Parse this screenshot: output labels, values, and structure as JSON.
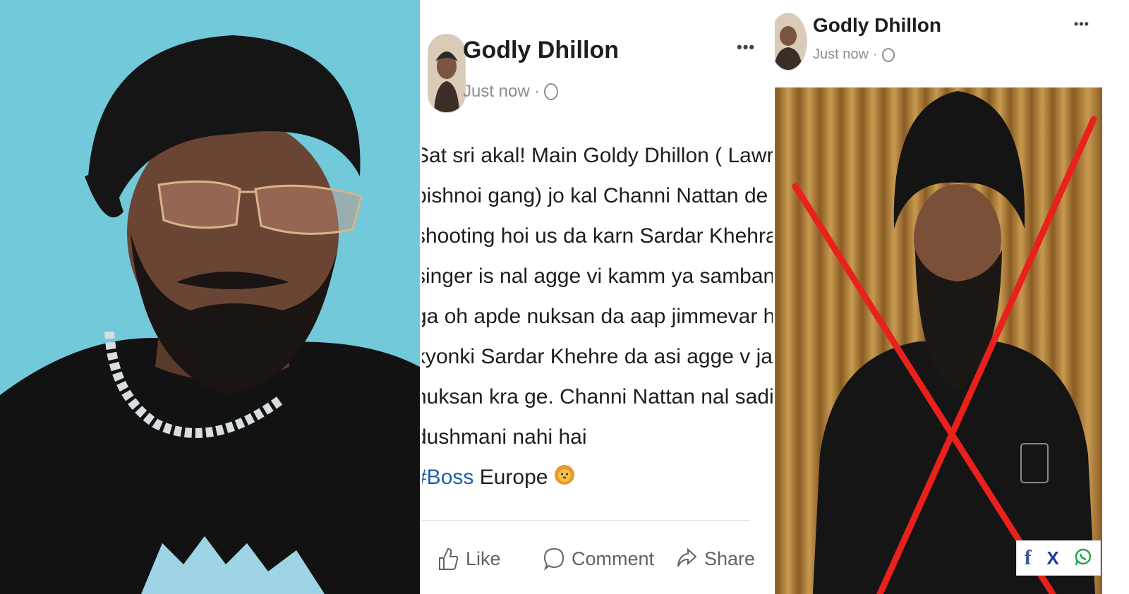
{
  "middle_post": {
    "author": "Godly Dhillon",
    "timestamp": "Just now",
    "separator": "·",
    "menu_icon": "more-dots-icon",
    "text_lines": [
      "Sat sri akal! Main Goldy Dhillon ( Lawrence",
      "bishnoi gang) jo kal Channi Nattan de ghar",
      "shooting hoi us da karn Sardar Khehra hai jo v",
      "singer is nal agge vi kamm ya sambandh rakhe",
      "ga oh apde nuksan da aap jimmevar hove ga",
      "kyonki Sardar Khehre da asi agge v jani mani",
      "nuksan kra ge. Channi Nattan nal sadi koi nijji",
      "dushmani nahi hai"
    ],
    "hashtag": "#Boss",
    "hashtag_suffix": "Europe",
    "emoji_icon": "lion-emoji-icon",
    "actions": {
      "like": "Like",
      "comment": "Comment",
      "share": "Share"
    }
  },
  "right_post": {
    "author": "Godly Dhillon",
    "timestamp": "Just now",
    "separator": "·",
    "menu_icon": "more-dots-icon"
  },
  "social_bar": {
    "facebook": "f",
    "x": "X",
    "whatsapp": "whatsapp-icon"
  },
  "colors": {
    "cross_red": "#e8211c",
    "hashtag_blue": "#1d5fa8",
    "photo_bg": "#6cc6d8",
    "curtain": "#b07d35"
  }
}
